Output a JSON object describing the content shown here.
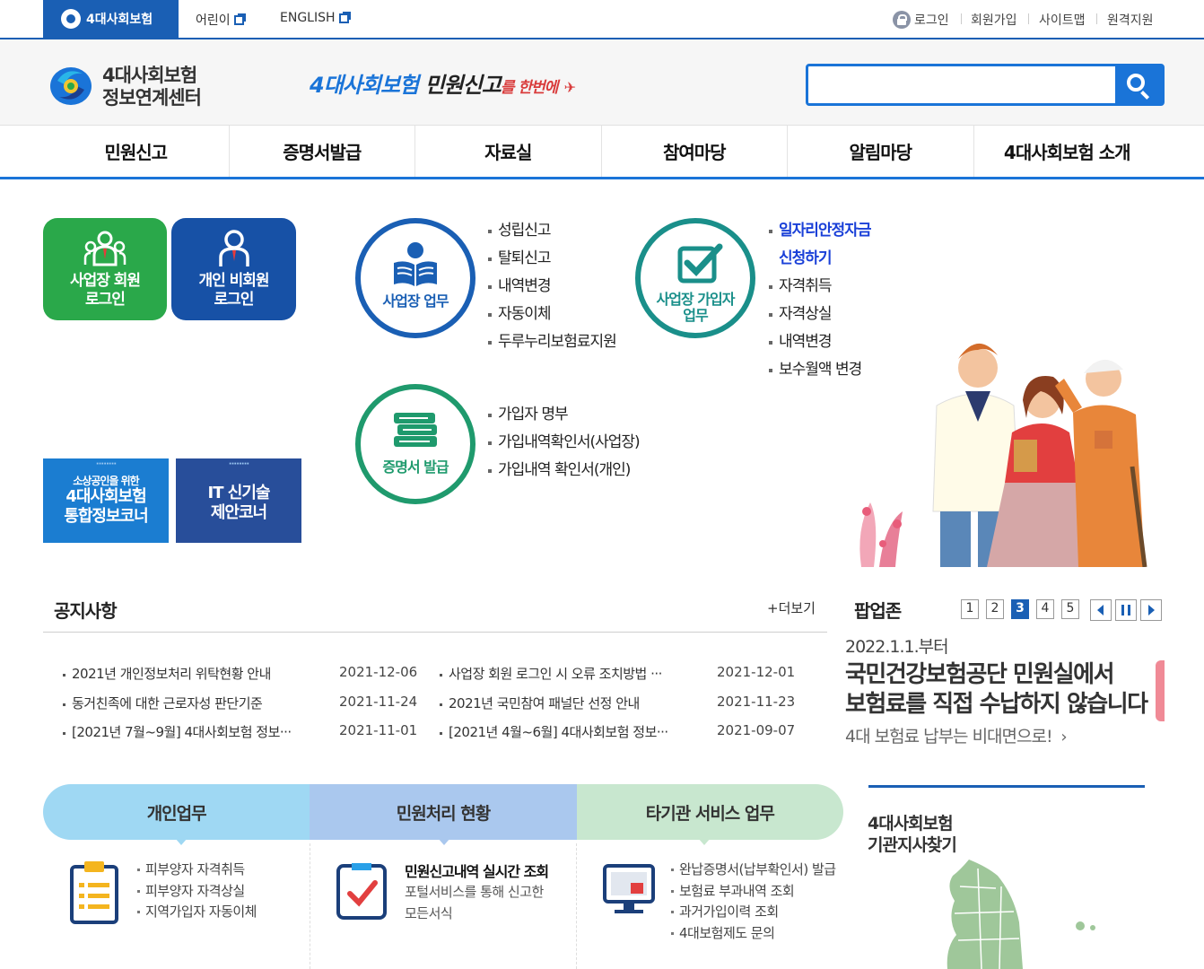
{
  "topbar": {
    "brand": "4대사회보험",
    "kids": "어린이",
    "english": "ENGLISH",
    "login": "로그인",
    "join": "회원가입",
    "sitemap": "사이트맵",
    "remote": "원격지원"
  },
  "header": {
    "logo_line1": "4대사회보험",
    "logo_line2": "정보연계센터",
    "slogan_part1": "4대사회보험 ",
    "slogan_part2": "민원신고",
    "slogan_part3": "를 한번에",
    "search_placeholder": ""
  },
  "nav": [
    "민원신고",
    "증명서발급",
    "자료실",
    "참여마당",
    "알림마당",
    "4대사회보험 소개"
  ],
  "login_tiles": {
    "business": "사업장 회원\n로그인",
    "business_l1": "사업장 회원",
    "business_l2": "로그인",
    "personal_l1": "개인 비회원",
    "personal_l2": "로그인"
  },
  "banners": {
    "b1_small": "소상공인을 위한",
    "b1_l1": "4대사회보험",
    "b1_l2": "통합정보코너",
    "b2_l1": "IT 신기술",
    "b2_l2": "제안코너"
  },
  "services": {
    "biz_work": "사업장 업무",
    "biz_items": [
      "성립신고",
      "탈퇴신고",
      "내역변경",
      "자동이체",
      "두루누리보험료지원"
    ],
    "member_work_l1": "사업장 가입자",
    "member_work_l2": "업무",
    "member_highlight_l1": "일자리안정자금",
    "member_highlight_l2": "신청하기",
    "member_items": [
      "자격취득",
      "자격상실",
      "내역변경",
      "보수월액 변경"
    ],
    "cert": "증명서 발급",
    "cert_items": [
      "가입자 명부",
      "가입내역확인서(사업장)",
      "가입내역 확인서(개인)"
    ]
  },
  "notice": {
    "title": "공지사항",
    "more": "+더보기",
    "items": [
      {
        "title": "2021년 개인정보처리 위탁현황 안내",
        "date": "2021-12-06"
      },
      {
        "title": "사업장 회원 로그인 시 오류 조치방법 ···",
        "date": "2021-12-01"
      },
      {
        "title": "동거친족에 대한 근로자성 판단기준",
        "date": "2021-11-24"
      },
      {
        "title": "2021년 국민참여 패널단 선정 안내",
        "date": "2021-11-23"
      },
      {
        "title": "[2021년 7월~9월] 4대사회보험 정보···",
        "date": "2021-11-01"
      },
      {
        "title": "[2021년 4월~6월] 4대사회보험 정보···",
        "date": "2021-09-07"
      }
    ]
  },
  "popup": {
    "title": "팝업존",
    "pages": [
      "1",
      "2",
      "3",
      "4",
      "5"
    ],
    "active_page": "3",
    "date": "2022.1.1.부터",
    "head_l1": "국민건강보험공단 민원실에서",
    "head_l2": "보험료를 직접 수납하지 않습니다",
    "sub": "4대 보험료 납부는 비대면으로!"
  },
  "bottom_tabs": {
    "personal": "개인업무",
    "status": "민원처리 현황",
    "other": "타기관 서비스 업무",
    "personal_items": [
      "피부양자 자격취득",
      "피부양자 자격상실",
      "지역가입자 자동이체"
    ],
    "status_title": "민원신고내역 실시간 조회",
    "status_desc_l1": "포털서비스를 통해 신고한",
    "status_desc_l2": "모든서식",
    "other_items": [
      "완납증명서(납부확인서) 발급",
      "보험료 부과내역 조회",
      "과거가입이력 조회",
      "4대보험제도 문의"
    ]
  },
  "branch": {
    "l1": "4대사회보험",
    "l2": "기관지사찾기"
  },
  "colors": {
    "primary_blue": "#1a5fb4",
    "accent_blue": "#1a74d8",
    "green": "#2aa84a",
    "highlight": "#1a40d8"
  }
}
